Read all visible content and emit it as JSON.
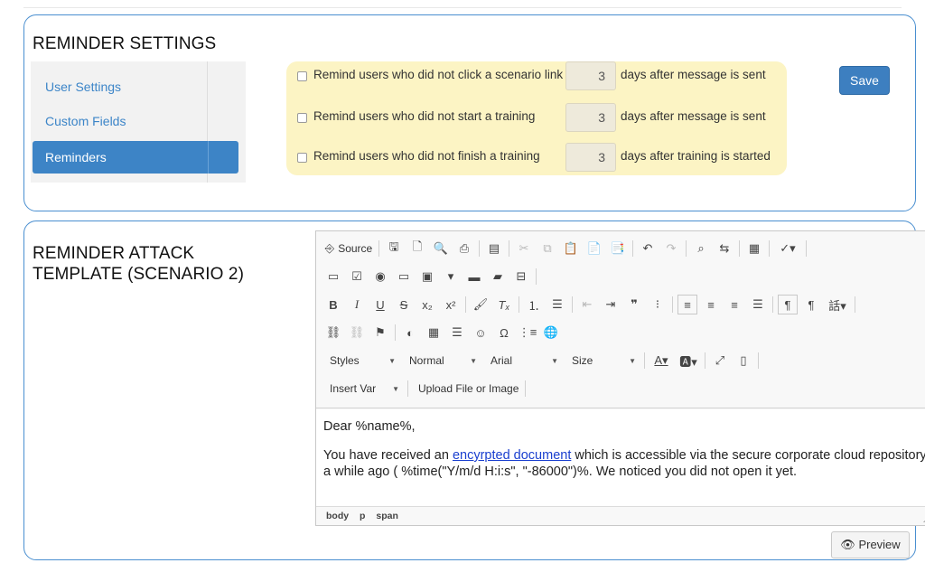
{
  "settings": {
    "title": "REMINDER SETTINGS",
    "nav": [
      {
        "label": "User Settings"
      },
      {
        "label": "Custom Fields"
      },
      {
        "label": "Reminders"
      }
    ],
    "reminders": [
      {
        "label": "Remind users who did not click a scenario link",
        "value": "3",
        "suffix": "days after message is sent",
        "checked": false
      },
      {
        "label": "Remind users who did not start a training",
        "value": "3",
        "suffix": "days after message is sent",
        "checked": false
      },
      {
        "label": "Remind users who did not finish a training",
        "value": "3",
        "suffix": "days after training is started",
        "checked": false
      }
    ],
    "save_label": "Save"
  },
  "template": {
    "title": "REMINDER ATTACK TEMPLATE (SCENARIO 2)",
    "toolbar": {
      "source_label": "Source",
      "styles_label": "Styles",
      "format_label": "Normal",
      "font_label": "Arial",
      "size_label": "Size",
      "insert_var_label": "Insert Var",
      "upload_label": "Upload File or Image"
    },
    "content": {
      "greeting": "Dear %name%,",
      "body_prefix": "You have received an ",
      "link_text": "encyrpted document",
      "body_suffix": " which is accessible via the secure corporate cloud repository a while ago ( %time(\"Y/m/d H:i:s\", \"-86000\")%. We noticed you did not open it yet."
    },
    "status_path": [
      "body",
      "p",
      "span"
    ],
    "preview_label": "Preview"
  },
  "colors": {
    "accent": "#3d84c6",
    "panel_border": "#4a8fd0",
    "reminder_bg": "#fcf4c4",
    "link": "#1a3fcf"
  }
}
